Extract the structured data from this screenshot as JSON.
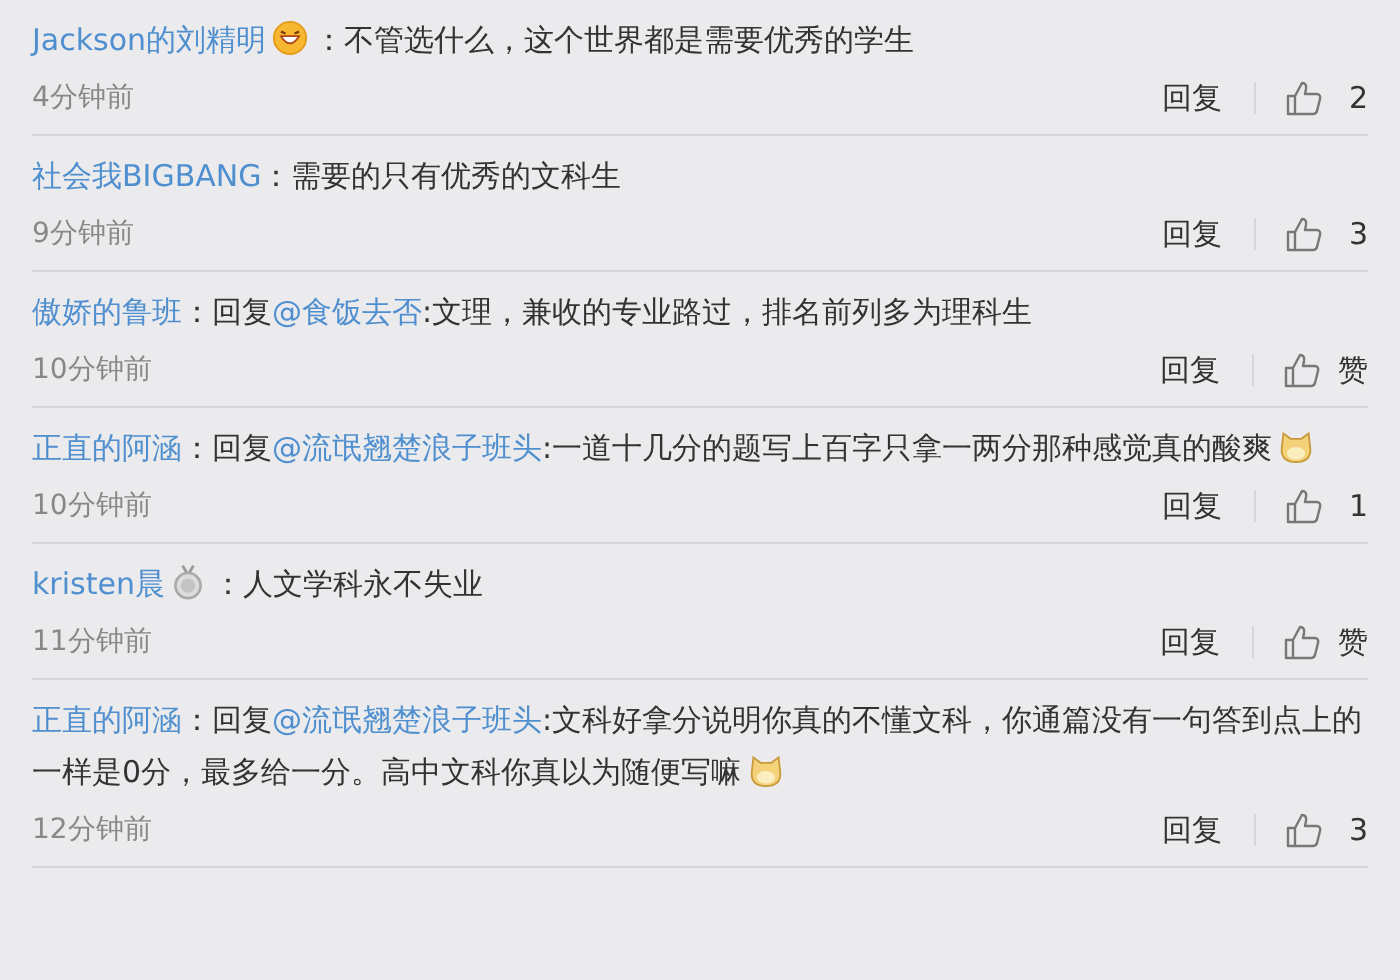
{
  "comments": [
    {
      "body": [
        {
          "kind": "link",
          "text": "Jackson的刘精明"
        },
        {
          "kind": "grin"
        },
        {
          "kind": "text",
          "text": "：不管选什么，这个世界都是需要优秀的学生"
        }
      ],
      "time": "4分钟前",
      "reply": "回复",
      "likes": "2"
    },
    {
      "body": [
        {
          "kind": "link",
          "text": "社会我BIGBANG"
        },
        {
          "kind": "text",
          "text": "：需要的只有优秀的文科生"
        }
      ],
      "time": "9分钟前",
      "reply": "回复",
      "likes": "3"
    },
    {
      "body": [
        {
          "kind": "link",
          "text": "傲娇的鲁班"
        },
        {
          "kind": "text",
          "text": "：回复"
        },
        {
          "kind": "link",
          "text": "@食饭去否"
        },
        {
          "kind": "text",
          "text": ":文理，兼收的专业路过，排名前列多为理科生"
        }
      ],
      "time": "10分钟前",
      "reply": "回复",
      "likes": "赞"
    },
    {
      "body": [
        {
          "kind": "link",
          "text": "正直的阿涵"
        },
        {
          "kind": "text",
          "text": "：回复"
        },
        {
          "kind": "link",
          "text": "@流氓翘楚浪子班头"
        },
        {
          "kind": "text",
          "text": ":一道十几分的题写上百字只拿一两分那种感觉真的酸爽"
        },
        {
          "kind": "dog"
        }
      ],
      "time": "10分钟前",
      "reply": "回复",
      "likes": "1"
    },
    {
      "body": [
        {
          "kind": "link",
          "text": "kristen晨"
        },
        {
          "kind": "medal"
        },
        {
          "kind": "text",
          "text": "：人文学科永不失业"
        }
      ],
      "time": "11分钟前",
      "reply": "回复",
      "likes": "赞"
    },
    {
      "body": [
        {
          "kind": "link",
          "text": "正直的阿涵"
        },
        {
          "kind": "text",
          "text": "：回复"
        },
        {
          "kind": "link",
          "text": "@流氓翘楚浪子班头"
        },
        {
          "kind": "text",
          "text": ":文科好拿分说明你真的不懂文科，你通篇没有一句答到点上的一样是0分，最多给一分。高中文科你真以为随便写嘛"
        },
        {
          "kind": "dog"
        }
      ],
      "time": "12分钟前",
      "reply": "回复",
      "likes": "3"
    }
  ]
}
